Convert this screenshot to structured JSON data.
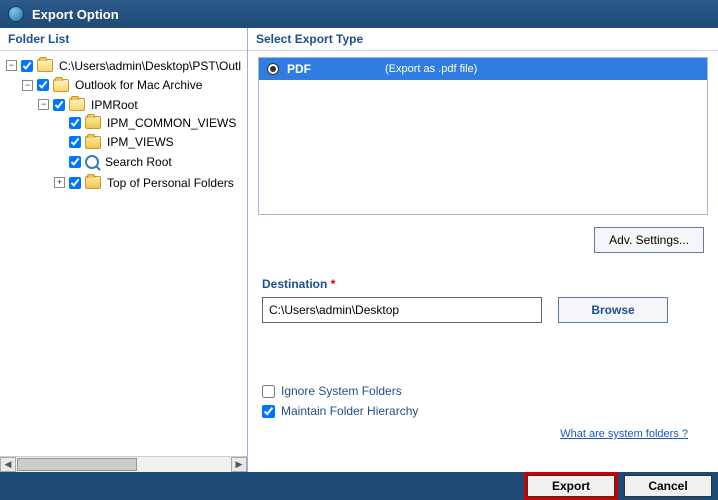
{
  "window": {
    "title": "Export Option"
  },
  "left_panel": {
    "header": "Folder List",
    "tree": {
      "root": {
        "label": "C:\\Users\\admin\\Desktop\\PST\\Outl",
        "children": [
          {
            "label": "Outlook for Mac Archive",
            "children": [
              {
                "label": "IPMRoot",
                "children": [
                  {
                    "label": "IPM_COMMON_VIEWS"
                  },
                  {
                    "label": "IPM_VIEWS"
                  },
                  {
                    "label": "Search Root",
                    "icon": "search"
                  },
                  {
                    "label": "Top of Personal Folders",
                    "exp": "+"
                  }
                ]
              }
            ]
          }
        ]
      }
    }
  },
  "right_panel": {
    "header": "Select Export Type",
    "types": [
      {
        "name": "PDF",
        "desc": "(Export as .pdf file)",
        "selected": true
      }
    ],
    "adv_settings": "Adv. Settings...",
    "destination": {
      "label": "Destination",
      "value": "C:\\Users\\admin\\Desktop",
      "browse": "Browse"
    },
    "options": {
      "ignore": {
        "label": "Ignore System Folders",
        "checked": false
      },
      "maintain": {
        "label": "Maintain Folder Hierarchy",
        "checked": true
      }
    },
    "system_link": "What are system folders ?"
  },
  "footer": {
    "export": "Export",
    "cancel": "Cancel"
  }
}
